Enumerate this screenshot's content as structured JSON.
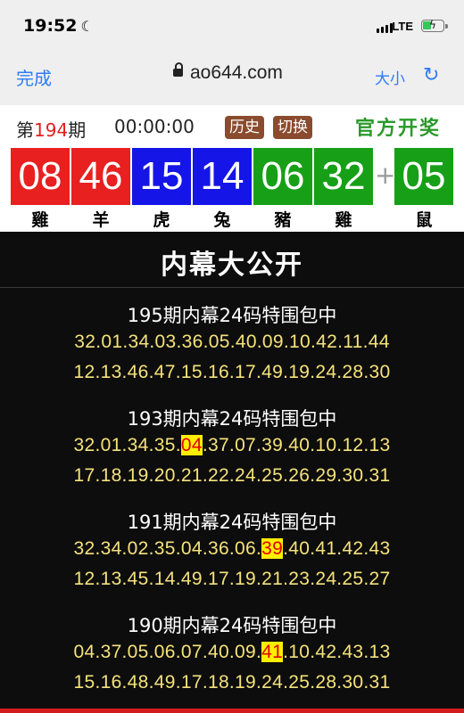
{
  "status_bar": {
    "time": "19:52",
    "network": "LTE"
  },
  "browser": {
    "done_label": "完成",
    "url": "ao644.com",
    "text_size_label": "大小"
  },
  "lottery": {
    "period_prefix": "第",
    "period_number": "194",
    "period_suffix": "期",
    "countdown": "00:00:00",
    "history_label": "历史",
    "switch_label": "切换",
    "official_label": "官方开奖",
    "balls": [
      {
        "number": "08",
        "zodiac": "雞",
        "color": "#e82020"
      },
      {
        "number": "46",
        "zodiac": "羊",
        "color": "#e82020"
      },
      {
        "number": "15",
        "zodiac": "虎",
        "color": "#1515e8"
      },
      {
        "number": "14",
        "zodiac": "兔",
        "color": "#1515e8"
      },
      {
        "number": "06",
        "zodiac": "豬",
        "color": "#17a017"
      },
      {
        "number": "32",
        "zodiac": "雞",
        "color": "#17a017"
      }
    ],
    "plus": "+",
    "special": {
      "number": "05",
      "zodiac": "鼠",
      "color": "#17a017"
    }
  },
  "banner": {
    "title": "内幕大公开"
  },
  "sections": [
    {
      "title": "195期内幕24码特围包中",
      "line1": "32.01.34.03.36.05.40.09.10.42.11.44",
      "line2": "12.13.46.47.15.16.17.49.19.24.28.30"
    },
    {
      "title": "193期内幕24码特围包中",
      "line1_before": "32.01.34.35.",
      "line1_hit": "04",
      "line1_after": ".37.07.39.40.10.12.13",
      "line2": "17.18.19.20.21.22.24.25.26.29.30.31"
    },
    {
      "title": "191期内幕24码特围包中",
      "line1_before": "32.34.02.35.04.36.06.",
      "line1_hit": "39",
      "line1_after": ".40.41.42.43",
      "line2": "12.13.45.14.49.17.19.21.23.24.25.27"
    },
    {
      "title": "190期内幕24码特围包中",
      "line1_before": "04.37.05.06.07.40.09.",
      "line1_hit": "41",
      "line1_after": ".10.42.43.13",
      "line2": "15.16.48.49.17.18.19.24.25.28.30.31"
    }
  ],
  "colors": {
    "highlight_bg": "#ffee00",
    "highlight_text": "#e00000",
    "numbers_text": "#f5e27a",
    "accent": "#2f7cf6"
  }
}
